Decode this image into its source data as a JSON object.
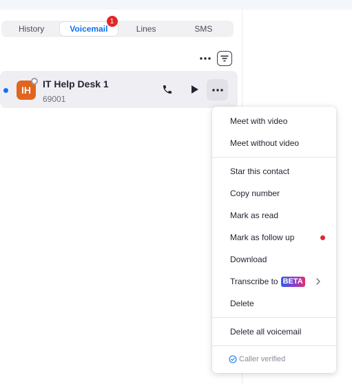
{
  "tabs": [
    {
      "label": "History",
      "active": false
    },
    {
      "label": "Voicemail",
      "active": true,
      "badge": "1"
    },
    {
      "label": "Lines",
      "active": false
    },
    {
      "label": "SMS",
      "active": false
    }
  ],
  "toolbar": {
    "more_icon": "more-horizontal-icon",
    "filter_icon": "filter-icon"
  },
  "voicemail": {
    "avatar_initials": "IH",
    "name": "IT Help Desk 1",
    "number": "69001",
    "avatar_color": "#e0651e",
    "unread_color": "#0e72ed"
  },
  "menu": {
    "items": [
      {
        "label": "Meet with video"
      },
      {
        "label": "Meet without video"
      },
      {
        "label": "Star this contact"
      },
      {
        "label": "Copy number"
      },
      {
        "label": "Mark as read"
      },
      {
        "label": "Mark as follow up"
      },
      {
        "label": "Download"
      },
      {
        "label": "Transcribe to"
      },
      {
        "label": "Delete"
      },
      {
        "label": "Delete all voicemail"
      }
    ],
    "beta_label": "BETA",
    "caller_verified": "Caller verified",
    "followup_dot_color": "#e02828"
  },
  "colors": {
    "accent": "#0e72ed",
    "badge": "#e02828"
  }
}
